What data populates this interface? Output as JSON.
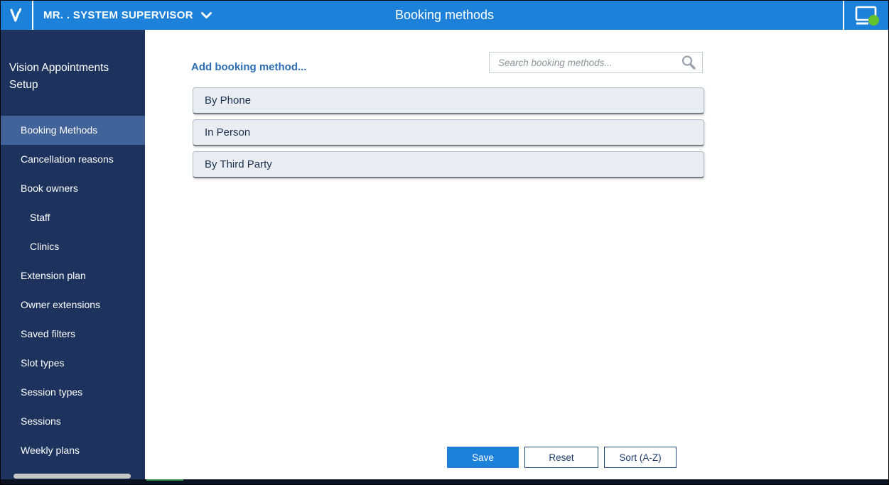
{
  "header": {
    "logo_letter": "V",
    "user_menu_label": "MR. . SYSTEM SUPERVISOR",
    "title": "Booking methods"
  },
  "sidebar": {
    "title": "Vision Appointments Setup",
    "items": [
      {
        "label": "Booking Methods",
        "selected": true,
        "indent": false
      },
      {
        "label": "Cancellation reasons",
        "selected": false,
        "indent": false
      },
      {
        "label": "Book owners",
        "selected": false,
        "indent": false
      },
      {
        "label": "Staff",
        "selected": false,
        "indent": true
      },
      {
        "label": "Clinics",
        "selected": false,
        "indent": true
      },
      {
        "label": "Extension plan",
        "selected": false,
        "indent": false
      },
      {
        "label": "Owner extensions",
        "selected": false,
        "indent": false
      },
      {
        "label": "Saved filters",
        "selected": false,
        "indent": false
      },
      {
        "label": "Slot types",
        "selected": false,
        "indent": false
      },
      {
        "label": "Session types",
        "selected": false,
        "indent": false
      },
      {
        "label": "Sessions",
        "selected": false,
        "indent": false
      },
      {
        "label": "Weekly plans",
        "selected": false,
        "indent": false
      }
    ]
  },
  "main": {
    "add_link_label": "Add booking method...",
    "search_placeholder": "Search booking methods...",
    "booking_methods": [
      "By Phone",
      "In Person",
      "By Third Party"
    ],
    "buttons": {
      "save": "Save",
      "reset": "Reset",
      "sort": "Sort (A-Z)"
    }
  },
  "colors": {
    "header_blue": "#1e81d9",
    "sidebar_navy": "#1d335e",
    "selected_item_blue": "#41639a",
    "link_blue": "#2e6db4",
    "save_button_blue": "#1e81d9",
    "status_green": "#62c22e",
    "list_item_bg": "#e9edf2",
    "text_navy": "#1c3050"
  }
}
